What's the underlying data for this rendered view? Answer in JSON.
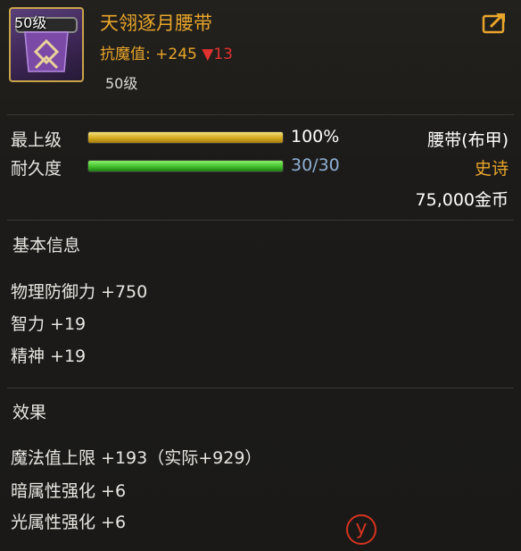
{
  "item": {
    "icon_level": "50级",
    "name": "天翎逐月腰带",
    "resist_label": "抗魔值:",
    "resist_value": "+245",
    "resist_change": "▼13",
    "required_level": "50级",
    "icon": "purple-belt-icon"
  },
  "header": {
    "share_icon": "share-icon"
  },
  "bars": {
    "grade_label": "最上级",
    "grade_value": "100%",
    "grade_fill": 1.0,
    "durability_label": "耐久度",
    "durability_value": "30/30",
    "durability_fill": 1.0
  },
  "meta": {
    "type": "腰带(布甲)",
    "rarity": "史诗",
    "price": "75,000金币"
  },
  "basic": {
    "title": "基本信息",
    "stats": [
      "物理防御力 +750",
      "智力 +19",
      "精神 +19"
    ]
  },
  "effects": {
    "title": "效果",
    "stats": [
      "魔法值上限 +193（实际+929）",
      "暗属性强化 +6",
      "光属性强化 +6"
    ]
  },
  "colors": {
    "name": "#e9a52b",
    "epic": "#e9a52b",
    "durability_value": "#8fb1d6",
    "decrease": "#e0322f",
    "frame": "#c9a54a"
  }
}
